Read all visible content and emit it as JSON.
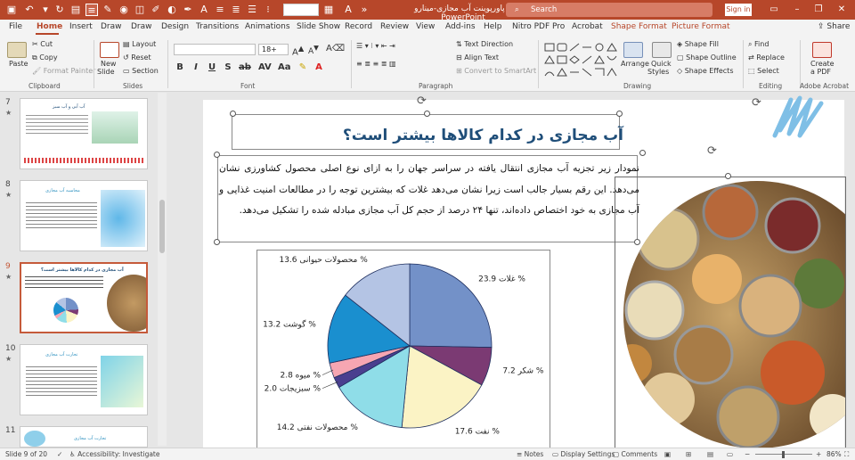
{
  "titlebar": {
    "doc_title": "پاورپوینت آب مجازی-مینارو",
    "app_name": "PowerPoint",
    "search_placeholder": "Search",
    "signin_label": "Sign in",
    "font_name_value": "",
    "accent_color": "#b7472a"
  },
  "tabs": [
    {
      "label": "File"
    },
    {
      "label": "Home"
    },
    {
      "label": "Insert"
    },
    {
      "label": "Draw"
    },
    {
      "label": "Draw"
    },
    {
      "label": "Design"
    },
    {
      "label": "Transitions"
    },
    {
      "label": "Animations"
    },
    {
      "label": "Slide Show"
    },
    {
      "label": "Record"
    },
    {
      "label": "Review"
    },
    {
      "label": "View"
    },
    {
      "label": "Add-ins"
    },
    {
      "label": "Help"
    },
    {
      "label": "Nitro PDF Pro"
    },
    {
      "label": "Acrobat"
    },
    {
      "label": "Shape Format"
    },
    {
      "label": "Picture Format"
    }
  ],
  "share_label": "Share",
  "ribbon": {
    "clipboard": {
      "paste": "Paste",
      "cut": "Cut",
      "copy": "Copy",
      "format_painter": "Format Painter",
      "label": "Clipboard"
    },
    "slides": {
      "new_slide": "New",
      "new_slide2": "Slide",
      "layout": "Layout",
      "reset": "Reset",
      "section": "Section",
      "label": "Slides"
    },
    "font": {
      "size": "18+",
      "label": "Font"
    },
    "paragraph": {
      "text_direction": "Text Direction",
      "align_text": "Align Text",
      "smartart": "Convert to SmartArt",
      "label": "Paragraph"
    },
    "drawing": {
      "arrange": "Arrange",
      "quick_styles": "Quick",
      "quick_styles2": "Styles",
      "shape_fill": "Shape Fill",
      "shape_outline": "Shape Outline",
      "shape_effects": "Shape Effects",
      "label": "Drawing"
    },
    "editing": {
      "find": "Find",
      "replace": "Replace",
      "select": "Select",
      "label": "Editing"
    },
    "adobe": {
      "create_pdf": "Create",
      "create_pdf2": "a PDF",
      "label": "Adobe Acrobat"
    }
  },
  "thumbnails": [
    {
      "num": "7",
      "title": "آب آبی و آب سبز"
    },
    {
      "num": "8",
      "title": "محاسبه آب مجازی"
    },
    {
      "num": "9",
      "title": "آب مجازی در کدام کالاها بیشتر است؟"
    },
    {
      "num": "10",
      "title": "تجارت آب مجازی"
    },
    {
      "num": "11",
      "title": "تجارت آب مجازی"
    }
  ],
  "slide": {
    "title": "آب مجازی در کدام کالاها بیشتر است؟",
    "body": "نمودار زیر تجزیه آب مجازی انتقال یافته در سراسر جهان را به ازای نوع اصلی محصول کشاورزی نشان می‌دهد. این رقم بسیار جالب است زیرا نشان می‌دهد غلات که بیشترین توجه را در مطالعات امنیت غذایی و آب مجازی به خود اختصاص داده‌اند، تنها ۲۴ درصد از حجم کل آب مجازی مبادله شده را تشکیل می‌دهد."
  },
  "chart_data": {
    "type": "pie",
    "title": "",
    "slices": [
      {
        "label": "غلات",
        "value": 23.9,
        "display": "23.9 %",
        "color": "#7391c8"
      },
      {
        "label": "شکر",
        "value": 7.2,
        "display": "7.2 %",
        "color": "#7b3a73"
      },
      {
        "label": "نفت",
        "value": 17.6,
        "display": "17.6 %",
        "color": "#fbf3c5"
      },
      {
        "label": "محصولات نفتی",
        "value": 14.2,
        "display": "14.2 %",
        "color": "#8fdde8"
      },
      {
        "label": "سبزیجات",
        "value": 2.0,
        "display": "2.0 %",
        "color": "#4a3f8f"
      },
      {
        "label": "میوه",
        "value": 2.8,
        "display": "2.8 %",
        "color": "#f6a6b2"
      },
      {
        "label": "گوشت",
        "value": 13.2,
        "display": "13.2 %",
        "color": "#1a8fcf"
      },
      {
        "label": "محصولات حیوانی",
        "value": 13.6,
        "display": "13.6 %",
        "color": "#b4c4e4"
      }
    ]
  },
  "status": {
    "slide_info": "Slide 9 of 20",
    "accessibility": "Accessibility: Investigate",
    "notes": "Notes",
    "display_settings": "Display Settings",
    "comments": "Comments",
    "zoom": "86%"
  }
}
